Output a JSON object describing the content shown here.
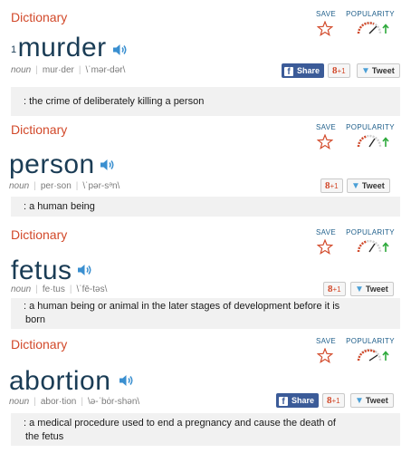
{
  "entries": [
    {
      "dict_label": "Dictionary",
      "save_label": "SAVE",
      "popularity_label": "POPULARITY",
      "superscript": "1",
      "word": "murder",
      "pos": "noun",
      "syllables": "mur·der",
      "pronunciation": "\\ˈmər-dər\\",
      "share_label": "Share",
      "gplus_label": "+1",
      "tweet_label": "Tweet",
      "definition": ": the crime of deliberately killing a person"
    },
    {
      "dict_label": "Dictionary",
      "save_label": "SAVE",
      "popularity_label": "POPULARITY",
      "word": "person",
      "pos": "noun",
      "syllables": "per·son",
      "pronunciation": "\\ˈpər-sᵊn\\",
      "gplus_label": "+1",
      "tweet_label": "Tweet",
      "definition": ": a human being"
    },
    {
      "dict_label": "Dictionary",
      "save_label": "SAVE",
      "popularity_label": "POPULARITY",
      "word": "fetus",
      "pos": "noun",
      "syllables": "fe·tus",
      "pronunciation": "\\ˈfē-təs\\",
      "gplus_label": "+1",
      "tweet_label": "Tweet",
      "definition_line1": ": a human being or animal in the later stages of development before it is",
      "definition_line2": "born"
    },
    {
      "dict_label": "Dictionary",
      "save_label": "SAVE",
      "popularity_label": "POPULARITY",
      "word": "abortion",
      "pos": "noun",
      "syllables": "abor·tion",
      "pronunciation": "\\ə-ˈbȯr-shən\\",
      "share_label": "Share",
      "gplus_label": "+1",
      "tweet_label": "Tweet",
      "definition_line1": ": a medical procedure used to end a pregnancy and cause the death of",
      "definition_line2": "the fetus"
    }
  ],
  "icons": {
    "speaker": "speaker-icon",
    "star": "star-outline-icon",
    "popularity": "popularity-gauge-icon",
    "facebook": "facebook-icon",
    "gplus": "google-plus-icon",
    "twitter": "twitter-bird-icon"
  },
  "colors": {
    "dictionary_label": "#d2492a",
    "headword": "#1a3c55",
    "speaker": "#3a8fd0",
    "facebook": "#3b5b98",
    "twitter": "#4a9fd6",
    "popularity_arrow": "#2eaa3c",
    "definition_bg": "#f1f1f1"
  }
}
